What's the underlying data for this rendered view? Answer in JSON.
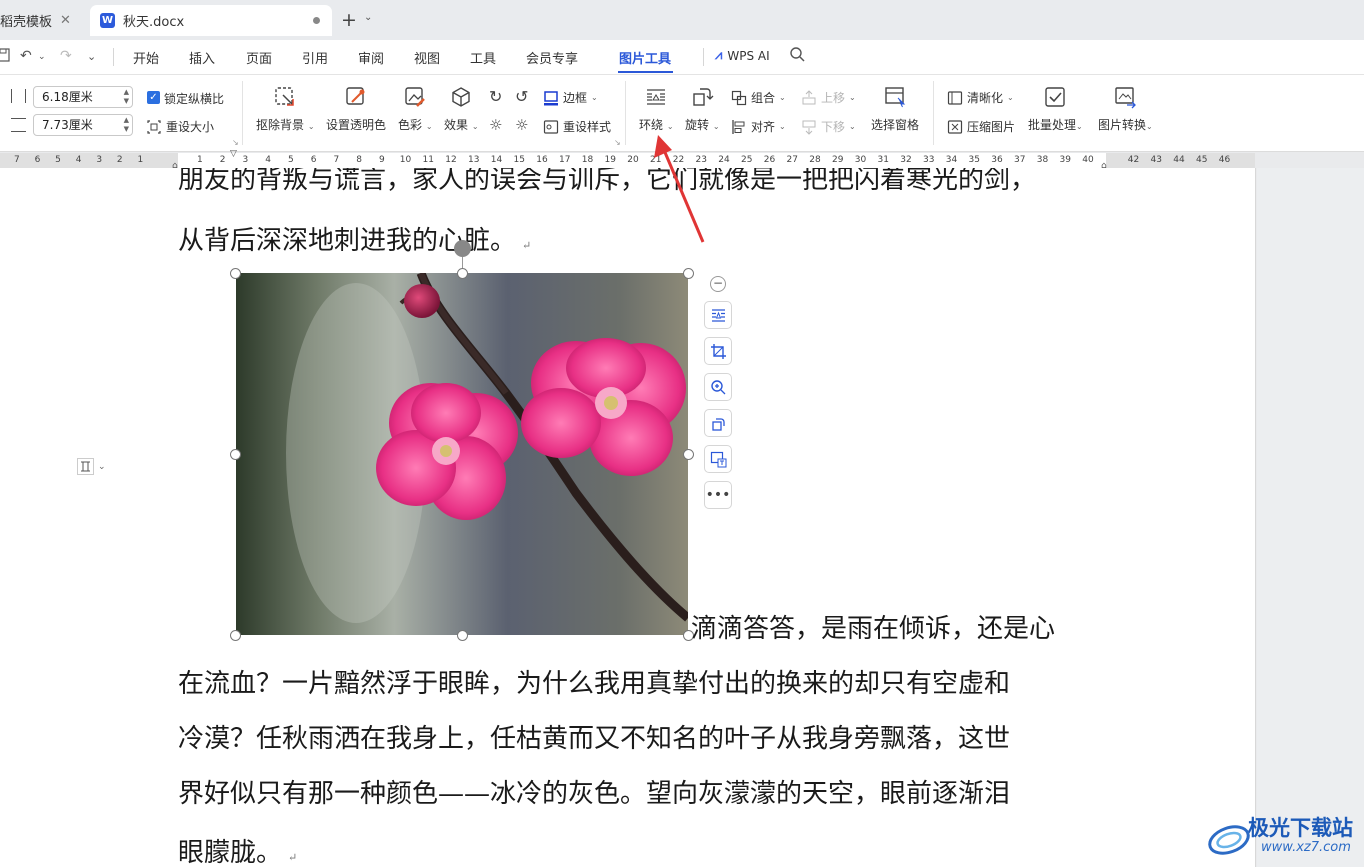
{
  "tabs": [
    {
      "label": "稻壳模板",
      "active": false
    },
    {
      "label": "秋天.docx",
      "active": true,
      "icon_letter": "W"
    }
  ],
  "new_tab": "+",
  "menu": {
    "items": [
      "开始",
      "插入",
      "页面",
      "引用",
      "审阅",
      "视图",
      "工具",
      "会员专享",
      "图片工具"
    ],
    "active": "图片工具",
    "wps_ai": "WPS AI"
  },
  "ribbon": {
    "width_value": "6.18厘米",
    "height_value": "7.73厘米",
    "lock_ratio": "锁定纵横比",
    "lock_ratio_checked": true,
    "reset_size": "重设大小",
    "remove_bg": "抠除背景",
    "set_transparent": "设置透明色",
    "color": "色彩",
    "effects": "效果",
    "border": "边框",
    "reset_style": "重设样式",
    "wrap": "环绕",
    "rotate": "旋转",
    "group": "组合",
    "align": "对齐",
    "bring_forward": "上移",
    "send_backward": "下移",
    "selection_pane": "选择窗格",
    "sharpen": "清晰化",
    "compress": "压缩图片",
    "batch": "批量处理",
    "convert": "图片转换"
  },
  "ruler": {
    "left_numbers": "7 6 5 4 3 2 1",
    "right_numbers": [
      "1",
      "2",
      "3",
      "4",
      "5",
      "6",
      "7",
      "8",
      "9",
      "10",
      "11",
      "12",
      "13",
      "14",
      "15",
      "16",
      "17",
      "18",
      "19",
      "20",
      "21",
      "22",
      "23",
      "24",
      "25",
      "26",
      "27",
      "28",
      "29",
      "30",
      "31",
      "32",
      "33",
      "34",
      "35",
      "36",
      "37",
      "38",
      "39",
      "40",
      "42",
      "43",
      "44",
      "45",
      "46"
    ]
  },
  "document": {
    "line0": "朋友的背叛与谎言，家人的误会与训斥，它们就像是一把把闪着寒光的剑，",
    "line1": "从背后深深地刺进我的心脏。",
    "line2": "滴滴答答，是雨在倾诉，还是心",
    "line3": "在流血？一片黯然浮于眼眸，为什么我用真挚付出的换来的却只有空虚和",
    "line4": "冷漠？任秋雨洒在我身上，任枯黄而又不知名的叶子从我身旁飘落，这世",
    "line5": "界好似只有那一种颜色——冰冷的灰色。望向灰濛濛的天空，眼前逐渐泪",
    "line6": "眼朦胧。",
    "return_mark": "↵"
  },
  "colors": {
    "accent": "#2b58d8",
    "arrow": "#e03535",
    "flower": "#e0327a"
  },
  "watermark": {
    "title": "极光下载站",
    "url": "www.xz7.com"
  }
}
